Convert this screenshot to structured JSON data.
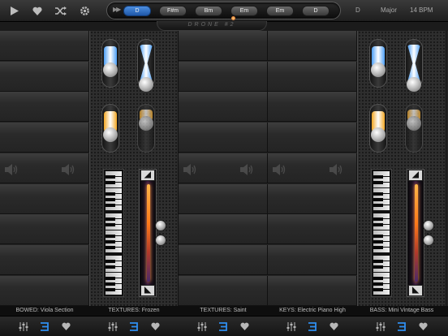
{
  "toolbar": {
    "play_icon": "play-icon",
    "favorite_icon": "heart-icon",
    "shuffle_icon": "shuffle-icon",
    "settings_icon": "gear-icon",
    "transport_icon": "fast-forward-icon"
  },
  "chords": [
    "D",
    "F#m",
    "Bm",
    "Em",
    "Em",
    "D"
  ],
  "active_chord_index": 0,
  "drone_label": "DRONE #2",
  "key": "D",
  "scale": "Major",
  "tempo": "14 BPM",
  "tracks": [
    {
      "label": "BOWED: Viola Section",
      "active": false
    },
    {
      "label": "TEXTURES: Frozen",
      "active": true
    },
    {
      "label": "TEXTURES: Saint",
      "active": false
    },
    {
      "label": "KEYS: Electric Piano High",
      "active": false
    },
    {
      "label": "BASS: Mini Vintage Bass",
      "active": true
    }
  ],
  "colors": {
    "accent_blue": "#2f8ef0",
    "active_chord": "#3d7fd3",
    "liquid_blue": "#4b9ef5",
    "liquid_orange": "#f2a623",
    "glow_orange": "#ff8a2a"
  },
  "footer": {
    "mixer_icon": "mixer-icon",
    "pattern_icon": "pattern-icon",
    "favorite_icon": "heart-icon"
  }
}
